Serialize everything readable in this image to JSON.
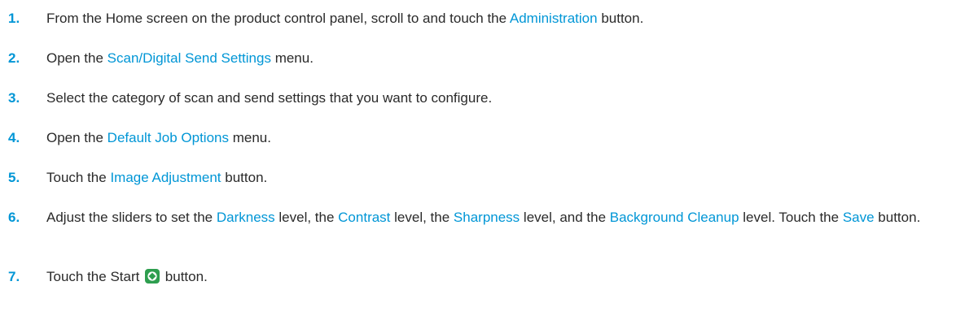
{
  "steps": [
    {
      "num": "1.",
      "parts": [
        {
          "t": "From the Home screen on the product control panel, scroll to and touch the "
        },
        {
          "t": "Administration",
          "hl": true
        },
        {
          "t": " button."
        }
      ]
    },
    {
      "num": "2.",
      "parts": [
        {
          "t": "Open the "
        },
        {
          "t": "Scan/Digital Send Settings",
          "hl": true
        },
        {
          "t": " menu."
        }
      ]
    },
    {
      "num": "3.",
      "parts": [
        {
          "t": "Select the category of scan and send settings that you want to configure."
        }
      ]
    },
    {
      "num": "4.",
      "parts": [
        {
          "t": "Open the "
        },
        {
          "t": "Default Job Options",
          "hl": true
        },
        {
          "t": " menu."
        }
      ]
    },
    {
      "num": "5.",
      "parts": [
        {
          "t": "Touch the "
        },
        {
          "t": "Image Adjustment",
          "hl": true
        },
        {
          "t": " button."
        }
      ]
    },
    {
      "num": "6.",
      "parts": [
        {
          "t": "Adjust the sliders to set the "
        },
        {
          "t": "Darkness",
          "hl": true
        },
        {
          "t": " level, the "
        },
        {
          "t": "Contrast",
          "hl": true
        },
        {
          "t": " level, the "
        },
        {
          "t": "Sharpness",
          "hl": true
        },
        {
          "t": " level, and the "
        },
        {
          "t": "Background Cleanup",
          "hl": true
        },
        {
          "t": " level. Touch the "
        },
        {
          "t": "Save",
          "hl": true
        },
        {
          "t": " button."
        }
      ]
    },
    {
      "num": "7.",
      "parts": [
        {
          "t": "Touch the Start "
        },
        {
          "icon": "start-icon"
        },
        {
          "t": " button."
        }
      ]
    }
  ],
  "colors": {
    "highlight": "#0096d6",
    "text": "#2a2a2a",
    "start_icon_fill": "#2e9e4f"
  }
}
